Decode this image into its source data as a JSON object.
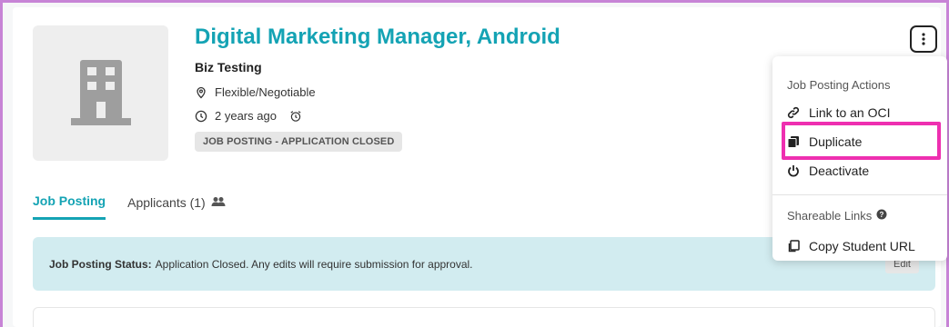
{
  "job": {
    "title": "Digital Marketing Manager, Android",
    "company": "Biz Testing",
    "location": "Flexible/Negotiable",
    "posted": "2 years ago",
    "status_pill": "JOB POSTING - APPLICATION CLOSED"
  },
  "tabs": [
    {
      "label": "Job Posting",
      "active": true
    },
    {
      "label": "Applicants (1)",
      "active": false
    }
  ],
  "banner": {
    "label": "Job Posting Status:",
    "text": "Application Closed. Any edits will require submission for approval.",
    "edit_label": "Edit"
  },
  "menu": {
    "header": "Job Posting Actions",
    "items": [
      {
        "label": "Link to an OCI",
        "icon": "link-icon"
      },
      {
        "label": "Duplicate",
        "icon": "duplicate-icon"
      },
      {
        "label": "Deactivate",
        "icon": "power-icon"
      }
    ],
    "share_header": "Shareable Links",
    "share_items": [
      {
        "label": "Copy Student URL",
        "icon": "copy-icon"
      }
    ]
  },
  "colors": {
    "accent": "#14a3b4",
    "highlight": "#ee2fb0",
    "banner_bg": "#d2ecf0",
    "frame": "#c784d6"
  }
}
